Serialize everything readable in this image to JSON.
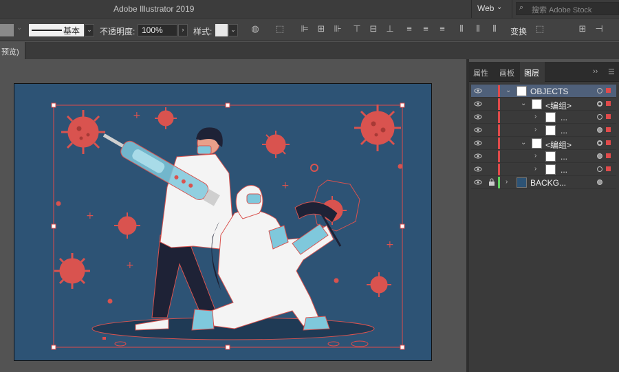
{
  "window": {
    "title": "Adobe Illustrator 2019",
    "workspace": "Web",
    "search_placeholder": "搜索 Adobe Stock"
  },
  "control_bar": {
    "stroke_label": "基本",
    "opacity_label": "不透明度:",
    "opacity_value": "100%",
    "style_label": "样式:",
    "transform_label": "变换"
  },
  "doc_tab": {
    "label": "预览)"
  },
  "panel": {
    "tabs": [
      "属性",
      "画板",
      "图层"
    ],
    "active_tab": "图层",
    "layers": [
      {
        "name": "OBJECTS",
        "level": 0,
        "expanded": true,
        "selected": true,
        "color": "#e04b4b"
      },
      {
        "name": "<编组>",
        "level": 1,
        "expanded": true,
        "selected": false,
        "color": "#e04b4b"
      },
      {
        "name": "...",
        "level": 2,
        "expanded": false,
        "selected": false,
        "color": "#e04b4b"
      },
      {
        "name": "...",
        "level": 2,
        "expanded": false,
        "selected": false,
        "color": "#e04b4b"
      },
      {
        "name": "<编组>",
        "level": 1,
        "expanded": true,
        "selected": false,
        "color": "#e04b4b"
      },
      {
        "name": "...",
        "level": 2,
        "expanded": false,
        "selected": false,
        "color": "#e04b4b"
      },
      {
        "name": "...",
        "level": 2,
        "expanded": false,
        "selected": false,
        "color": "#e04b4b"
      },
      {
        "name": "BACKG...",
        "level": 0,
        "expanded": false,
        "selected": false,
        "locked": true,
        "color": "#5fd35f"
      }
    ]
  },
  "colors": {
    "artboard_bg": "#2d5375",
    "selection": "#e04b4b",
    "virus": "#d9534f",
    "suit": "#f4f4f4",
    "glove": "#7fc8dc",
    "dark_pants": "#1e2236"
  }
}
